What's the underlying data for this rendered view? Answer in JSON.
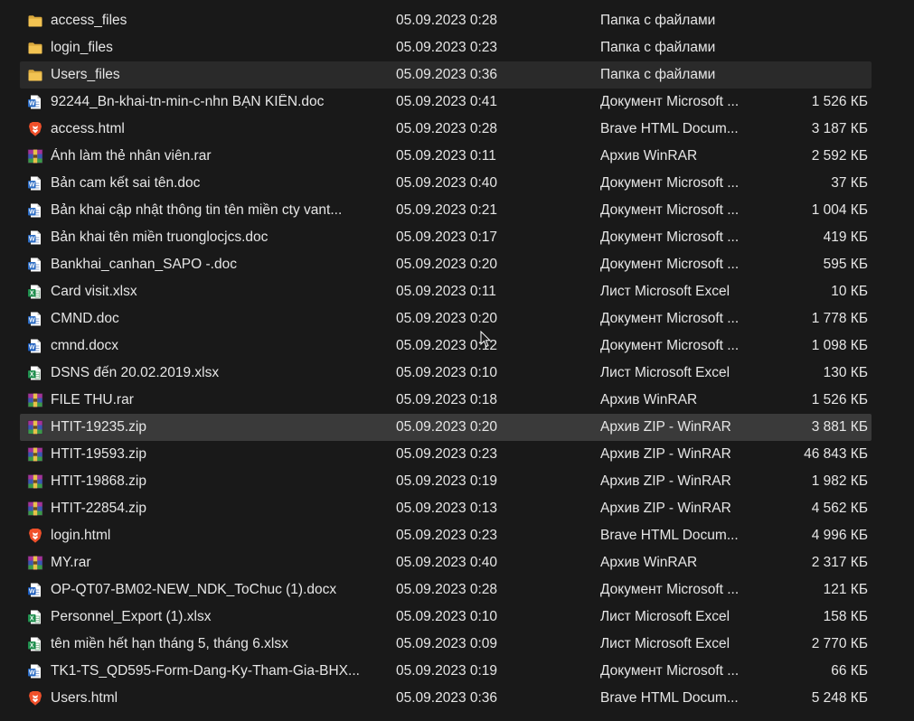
{
  "explorer": {
    "files": [
      {
        "name": "access_files",
        "date": "05.09.2023 0:28",
        "type": "Папка с файлами",
        "size": "",
        "icon": "folder-icon"
      },
      {
        "name": "login_files",
        "date": "05.09.2023 0:23",
        "type": "Папка с файлами",
        "size": "",
        "icon": "folder-icon"
      },
      {
        "name": "Users_files",
        "date": "05.09.2023 0:36",
        "type": "Папка с файлами",
        "size": "",
        "icon": "folder-icon",
        "state": "hovered"
      },
      {
        "name": "92244_Bn-khai-tn-min-c-nhn BẠN KIÊN.doc",
        "date": "05.09.2023 0:41",
        "type": "Документ Microsoft ...",
        "size": "1 526 КБ",
        "icon": "word-doc-icon"
      },
      {
        "name": "access.html",
        "date": "05.09.2023 0:28",
        "type": "Brave HTML Docum...",
        "size": "3 187 КБ",
        "icon": "brave-icon"
      },
      {
        "name": "Ảnh làm thẻ nhân viên.rar",
        "date": "05.09.2023 0:11",
        "type": "Архив WinRAR",
        "size": "2 592 КБ",
        "icon": "winrar-icon"
      },
      {
        "name": "Bản cam kết sai tên.doc",
        "date": "05.09.2023 0:40",
        "type": "Документ Microsoft ...",
        "size": "37 КБ",
        "icon": "word-doc-icon"
      },
      {
        "name": "Bản khai cập nhật thông tin tên miền cty vant...",
        "date": "05.09.2023 0:21",
        "type": "Документ Microsoft ...",
        "size": "1 004 КБ",
        "icon": "word-doc-icon"
      },
      {
        "name": "Bản khai tên miền truonglocjcs.doc",
        "date": "05.09.2023 0:17",
        "type": "Документ Microsoft ...",
        "size": "419 КБ",
        "icon": "word-doc-icon"
      },
      {
        "name": "Bankhai_canhan_SAPO -.doc",
        "date": "05.09.2023 0:20",
        "type": "Документ Microsoft ...",
        "size": "595 КБ",
        "icon": "word-doc-icon"
      },
      {
        "name": "Card visit.xlsx",
        "date": "05.09.2023 0:11",
        "type": "Лист Microsoft Excel",
        "size": "10 КБ",
        "icon": "excel-icon"
      },
      {
        "name": "CMND.doc",
        "date": "05.09.2023 0:20",
        "type": "Документ Microsoft ...",
        "size": "1 778 КБ",
        "icon": "word-doc-icon"
      },
      {
        "name": "cmnd.docx",
        "date": "05.09.2023 0:12",
        "type": "Документ Microsoft ...",
        "size": "1 098 КБ",
        "icon": "word-docx-icon"
      },
      {
        "name": "DSNS đến 20.02.2019.xlsx",
        "date": "05.09.2023 0:10",
        "type": "Лист Microsoft Excel",
        "size": "130 КБ",
        "icon": "excel-icon"
      },
      {
        "name": "FILE THU.rar",
        "date": "05.09.2023 0:18",
        "type": "Архив WinRAR",
        "size": "1 526 КБ",
        "icon": "winrar-icon"
      },
      {
        "name": "HTIT-19235.zip",
        "date": "05.09.2023 0:20",
        "type": "Архив ZIP - WinRAR",
        "size": "3 881 КБ",
        "icon": "winrar-icon",
        "state": "selected"
      },
      {
        "name": "HTIT-19593.zip",
        "date": "05.09.2023 0:23",
        "type": "Архив ZIP - WinRAR",
        "size": "46 843 КБ",
        "icon": "winrar-icon"
      },
      {
        "name": "HTIT-19868.zip",
        "date": "05.09.2023 0:19",
        "type": "Архив ZIP - WinRAR",
        "size": "1 982 КБ",
        "icon": "winrar-icon"
      },
      {
        "name": "HTIT-22854.zip",
        "date": "05.09.2023 0:13",
        "type": "Архив ZIP - WinRAR",
        "size": "4 562 КБ",
        "icon": "winrar-icon"
      },
      {
        "name": "login.html",
        "date": "05.09.2023 0:23",
        "type": "Brave HTML Docum...",
        "size": "4 996 КБ",
        "icon": "brave-icon"
      },
      {
        "name": "MY.rar",
        "date": "05.09.2023 0:40",
        "type": "Архив WinRAR",
        "size": "2 317 КБ",
        "icon": "winrar-icon"
      },
      {
        "name": "OP-QT07-BM02-NEW_NDK_ToChuc (1).docx",
        "date": "05.09.2023 0:28",
        "type": "Документ Microsoft ...",
        "size": "121 КБ",
        "icon": "word-docx-icon"
      },
      {
        "name": "Personnel_Export (1).xlsx",
        "date": "05.09.2023 0:10",
        "type": "Лист Microsoft Excel",
        "size": "158 КБ",
        "icon": "excel-icon"
      },
      {
        "name": "tên miền hết hạn tháng 5, tháng 6.xlsx",
        "date": "05.09.2023 0:09",
        "type": "Лист Microsoft Excel",
        "size": "2 770 КБ",
        "icon": "excel-icon"
      },
      {
        "name": "TK1-TS_QD595-Form-Dang-Ky-Tham-Gia-BHX...",
        "date": "05.09.2023 0:19",
        "type": "Документ Microsoft ...",
        "size": "66 КБ",
        "icon": "word-doc-icon"
      },
      {
        "name": "Users.html",
        "date": "05.09.2023 0:36",
        "type": "Brave HTML Docum...",
        "size": "5 248 КБ",
        "icon": "brave-icon"
      }
    ]
  },
  "colors": {
    "background": "#191919",
    "text": "#e6e6e6",
    "hover_row": "#2a2a2a",
    "selected_row": "#3a3a3a",
    "folder": "#e8b84a",
    "word": "#2b6cc4",
    "excel": "#1f8f4e",
    "brave": "#f0502a",
    "winrar": "#8c3a8a"
  }
}
